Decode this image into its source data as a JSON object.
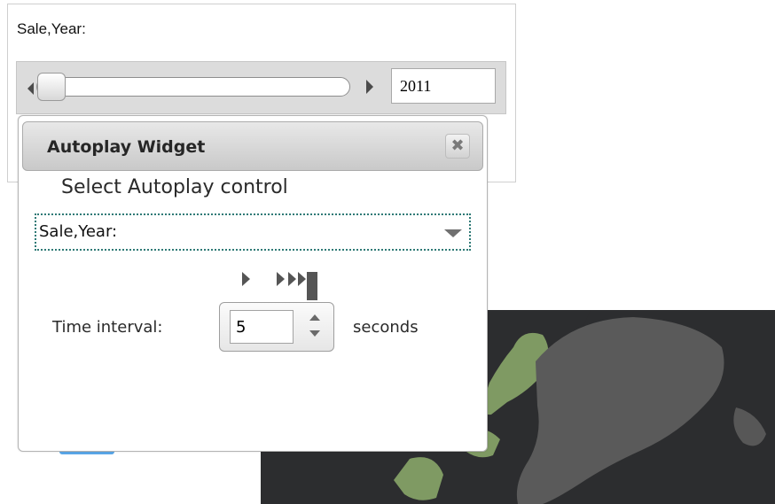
{
  "slider_panel": {
    "title": "Sale,Year:",
    "year_value": "2011",
    "slider_position": 0.0
  },
  "autoplay_widget": {
    "title": "Autoplay Widget",
    "close_icon": "close-icon",
    "subtitle": "Select Autoplay control",
    "selected_control": "Sale,Year:",
    "play_icon": "play-icon",
    "fast_forward_icon": "fast-forward-icon",
    "interval_label": "Time interval:",
    "interval_value": "5",
    "interval_unit": "seconds"
  },
  "colors": {
    "map_background": "#2c2d2f",
    "land_green": "#7f9a63",
    "land_gray": "#5a5a5a",
    "select_border": "#2f7a76",
    "tab_blue": "#5aa6e8"
  }
}
